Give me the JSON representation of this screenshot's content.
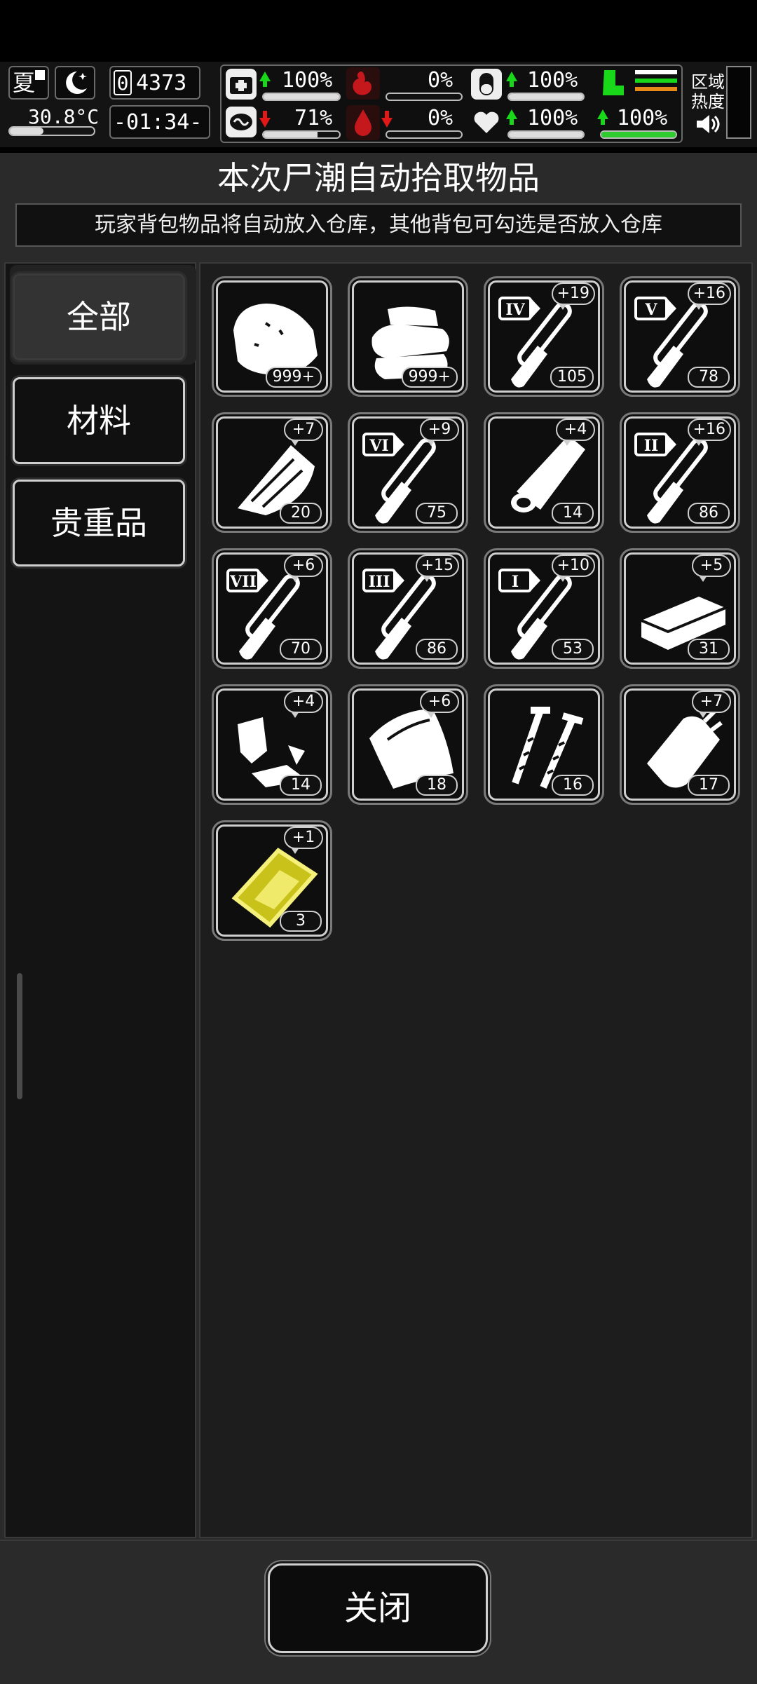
{
  "hud": {
    "season": "夏",
    "temperature": "30.8°C",
    "day_counter": "4373",
    "day_digit": "0",
    "clock": "-01:34-",
    "area_heat_label_1": "区域",
    "area_heat_label_2": "热度",
    "stats": {
      "health": "100%",
      "hunger": "0%",
      "pill": "100%",
      "brain": "71%",
      "blood": "0%",
      "heart": "100%",
      "stamina": "100%"
    },
    "levels": {
      "health": 1.0,
      "hunger": 0.0,
      "pill": 1.0,
      "brain": 0.71,
      "blood": 0.0,
      "heart": 1.0,
      "stamina": 1.0
    },
    "colors": {
      "up": "#19d819",
      "down": "#e01818",
      "accent_red": "#c4181d"
    }
  },
  "panel": {
    "title": "本次尸潮自动拾取物品",
    "subtitle": "玩家背包物品将自动放入仓库，其他背包可勾选是否放入仓库"
  },
  "categories": [
    {
      "label": "全部",
      "active": true
    },
    {
      "label": "材料",
      "active": false
    },
    {
      "label": "贵重品",
      "active": false
    }
  ],
  "items": [
    {
      "icon": "meat-chunk-icon",
      "qty": "999+",
      "plus": ""
    },
    {
      "icon": "cloth-pile-icon",
      "qty": "999+",
      "plus": ""
    },
    {
      "icon": "test-tube-iv-icon",
      "roman": "IV",
      "qty": "105",
      "plus": "+19"
    },
    {
      "icon": "test-tube-v-icon",
      "roman": "V",
      "qty": "78",
      "plus": "+16"
    },
    {
      "icon": "wood-plank-icon",
      "qty": "20",
      "plus": "+7"
    },
    {
      "icon": "test-tube-vi-icon",
      "roman": "VI",
      "qty": "75",
      "plus": "+9"
    },
    {
      "icon": "log-icon",
      "qty": "14",
      "plus": "+4"
    },
    {
      "icon": "test-tube-ii-icon",
      "roman": "II",
      "qty": "86",
      "plus": "+16"
    },
    {
      "icon": "test-tube-vii-icon",
      "roman": "VII",
      "qty": "70",
      "plus": "+6"
    },
    {
      "icon": "test-tube-iii-icon",
      "roman": "III",
      "qty": "86",
      "plus": "+15"
    },
    {
      "icon": "test-tube-i-icon",
      "roman": "I",
      "qty": "53",
      "plus": "+10"
    },
    {
      "icon": "brick-icon",
      "qty": "31",
      "plus": "+5"
    },
    {
      "icon": "scrap-parts-icon",
      "qty": "14",
      "plus": "+4"
    },
    {
      "icon": "leather-sheet-icon",
      "qty": "18",
      "plus": "+6"
    },
    {
      "icon": "screws-icon",
      "qty": "16",
      "plus": ""
    },
    {
      "icon": "plastic-bag-icon",
      "qty": "17",
      "plus": "+7"
    },
    {
      "icon": "gold-plate-icon",
      "qty": "3",
      "plus": "+1"
    }
  ],
  "footer": {
    "close_label": "关闭"
  }
}
